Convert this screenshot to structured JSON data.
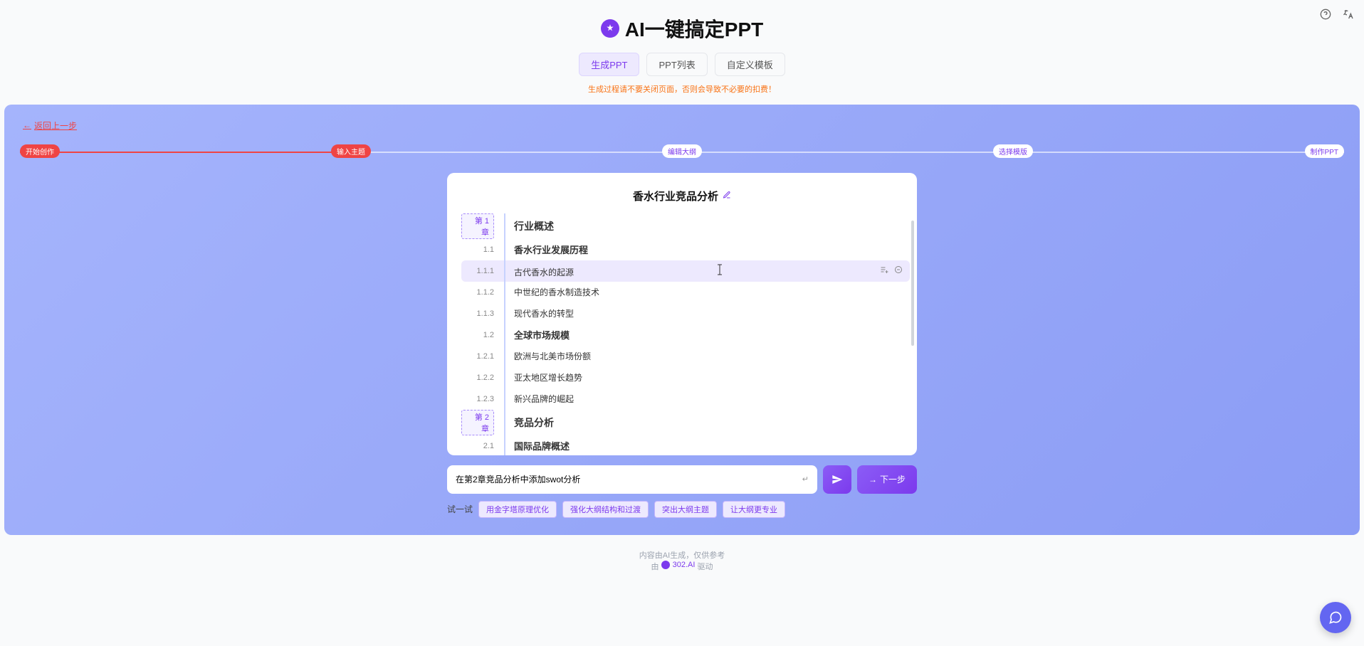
{
  "header": {
    "title": "AI一键搞定PPT",
    "tabs": [
      "生成PPT",
      "PPT列表",
      "自定义模板"
    ],
    "warn": "生成过程请不要关闭页面，否则会导致不必要的扣费！"
  },
  "top_icons": {
    "help": "?",
    "lang": "文A"
  },
  "panel": {
    "back": "返回上一步",
    "steps": [
      "开始创作",
      "输入主题",
      "编辑大纲",
      "选择模版",
      "制作PPT"
    ],
    "progress_fill_pct": 25
  },
  "card": {
    "title": "香水行业竞品分析",
    "outline": [
      {
        "kind": "chapter",
        "num": "第 1 章",
        "txt": "行业概述"
      },
      {
        "kind": "section",
        "num": "1.1",
        "txt": "香水行业发展历程"
      },
      {
        "kind": "item",
        "num": "1.1.1",
        "txt": "古代香水的起源",
        "hover": true
      },
      {
        "kind": "item",
        "num": "1.1.2",
        "txt": "中世纪的香水制造技术"
      },
      {
        "kind": "item",
        "num": "1.1.3",
        "txt": "现代香水的转型"
      },
      {
        "kind": "section",
        "num": "1.2",
        "txt": "全球市场规模"
      },
      {
        "kind": "item",
        "num": "1.2.1",
        "txt": "欧洲与北美市场份额"
      },
      {
        "kind": "item",
        "num": "1.2.2",
        "txt": "亚太地区增长趋势"
      },
      {
        "kind": "item",
        "num": "1.2.3",
        "txt": "新兴品牌的崛起"
      },
      {
        "kind": "chapter",
        "num": "第 2 章",
        "txt": "竞品分析"
      },
      {
        "kind": "section",
        "num": "2.1",
        "txt": "国际品牌概述"
      }
    ]
  },
  "input": {
    "value": "在第2章竞品分析中添加swot分析",
    "kbd": "↵",
    "next": "下一步",
    "suggest_label": "试一试",
    "suggestions": [
      "用金字塔原理优化",
      "强化大纲结构和过渡",
      "突出大纲主题",
      "让大纲更专业"
    ]
  },
  "footer": {
    "l1": "内容由AI生成，仅供参考",
    "l2_prefix": "由",
    "l2_brand": "302.AI",
    "l2_suffix": "驱动"
  }
}
